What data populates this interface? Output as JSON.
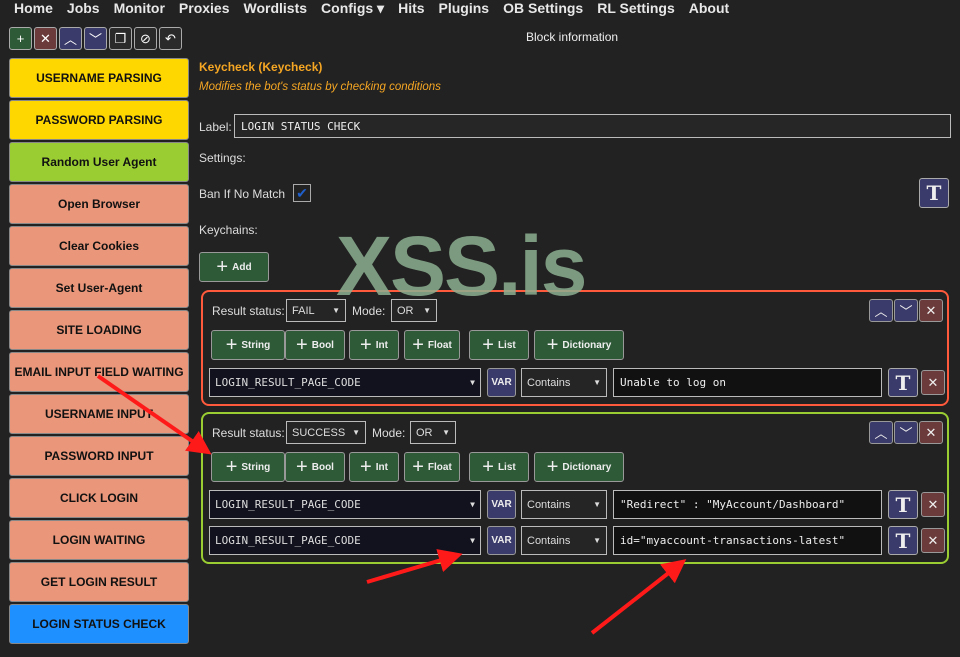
{
  "nav": [
    "Home",
    "Jobs",
    "Monitor",
    "Proxies",
    "Wordlists",
    "Configs ▾",
    "Hits",
    "Plugins",
    "OB Settings",
    "RL Settings",
    "About"
  ],
  "toolbar": [
    {
      "icon": "plus-icon",
      "glyph": "+",
      "color": "#2f5a38"
    },
    {
      "icon": "close-icon",
      "glyph": "✕",
      "color": "#6b3a3a"
    },
    {
      "icon": "chevron-up-icon",
      "glyph": "︿",
      "color": "#3b3b6b"
    },
    {
      "icon": "chevron-down-icon",
      "glyph": "﹀",
      "color": "#3b3b6b"
    },
    {
      "icon": "clone-icon",
      "glyph": "❐",
      "color": "#2a2a2a"
    },
    {
      "icon": "disable-icon",
      "glyph": "⊘",
      "color": "#2a2a2a"
    },
    {
      "icon": "undo-icon",
      "glyph": "↶",
      "color": "#2a2a2a"
    }
  ],
  "blocks": [
    {
      "label": "USERNAME PARSING",
      "color": "#ffd700"
    },
    {
      "label": "PASSWORD PARSING",
      "color": "#ffd700"
    },
    {
      "label": "Random User Agent",
      "color": "#9acd32"
    },
    {
      "label": "Open Browser",
      "color": "#e9967a"
    },
    {
      "label": "Clear Cookies",
      "color": "#e9967a"
    },
    {
      "label": "Set User-Agent",
      "color": "#e9967a"
    },
    {
      "label": "SITE LOADING",
      "color": "#e9967a"
    },
    {
      "label": "EMAIL INPUT FIELD WAITING",
      "color": "#e9967a"
    },
    {
      "label": "USERNAME INPUT",
      "color": "#e9967a"
    },
    {
      "label": "PASSWORD INPUT",
      "color": "#e9967a"
    },
    {
      "label": "CLICK LOGIN",
      "color": "#e9967a"
    },
    {
      "label": "LOGIN WAITING",
      "color": "#e9967a"
    },
    {
      "label": "GET LOGIN RESULT",
      "color": "#e9967a"
    },
    {
      "label": "LOGIN STATUS CHECK",
      "color": "#1e90ff"
    }
  ],
  "panel": {
    "header": "Block information",
    "title": "Keycheck (Keycheck)",
    "description": "Modifies the bot's status by checking conditions",
    "label_caption": "Label:",
    "label_value": "LOGIN STATUS CHECK",
    "settings": "Settings:",
    "ban_if_no_match": "Ban If No Match",
    "ban_checked": true,
    "keychains": "Keychains:",
    "add": "Add",
    "result_status": "Result status:",
    "mode": "Mode:",
    "add_buttons": [
      "String",
      "Bool",
      "Int",
      "Float",
      "List",
      "Dictionary"
    ],
    "var": "VAR",
    "chains": [
      {
        "status": "FAIL",
        "mode": "OR",
        "border": "#ff5a3c",
        "keys": [
          {
            "variable": "LOGIN_RESULT_PAGE_CODE",
            "condition": "Contains",
            "value": "Unable to log on"
          }
        ]
      },
      {
        "status": "SUCCESS",
        "mode": "OR",
        "border": "#9acd32",
        "keys": [
          {
            "variable": "LOGIN_RESULT_PAGE_CODE",
            "condition": "Contains",
            "value": "\"Redirect\" : \"MyAccount/Dashboard\""
          },
          {
            "variable": "LOGIN_RESULT_PAGE_CODE",
            "condition": "Contains",
            "value": "id=\"myaccount-transactions-latest\""
          }
        ]
      }
    ]
  },
  "watermark": "XSS.is",
  "annotation_color": "#ff1a1a"
}
